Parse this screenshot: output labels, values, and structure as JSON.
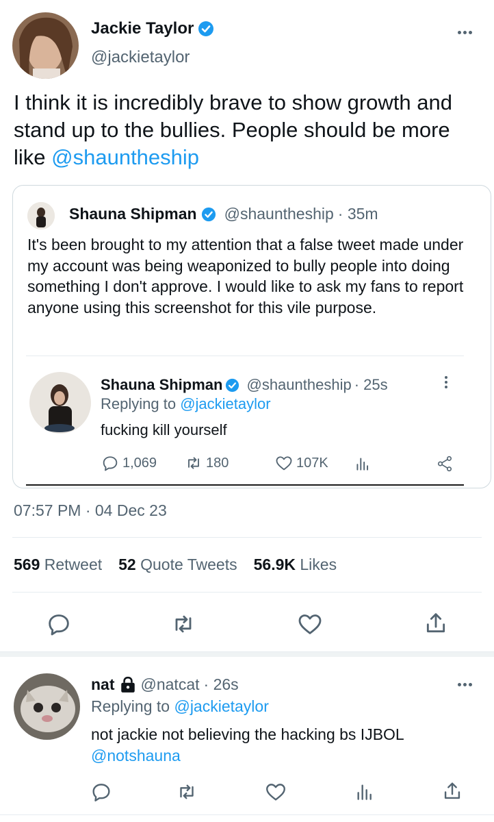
{
  "main_tweet": {
    "author_name": "Jackie Taylor",
    "author_handle": "@jackietaylor",
    "text_before": "I think it is incredibly brave to show growth and stand up to the bullies. People should be more like ",
    "mention": "@shauntheship",
    "timestamp": "07:57 PM · 04 Dec 23",
    "stats": {
      "retweets_count": "569",
      "retweets_label": "Retweet",
      "quotes_count": "52",
      "quotes_label": "Quote Tweets",
      "likes_count": "56.9K",
      "likes_label": "Likes"
    }
  },
  "quoted_tweet": {
    "author_name": "Shauna Shipman",
    "author_handle": "@shauntheship",
    "time": "· 35m",
    "text": "It's been brought to my attention that a false tweet made under my account was being weaponized to bully people into doing something I don't approve. I would like to ask my fans to report anyone using this screenshot for this vile purpose."
  },
  "inner_screenshot": {
    "author_name": "Shauna Shipman",
    "author_handle": "@shauntheship",
    "time": "· 25s",
    "replying_prefix": "Replying to ",
    "replying_to": "@jackietaylor",
    "text": "fucking kill yourself",
    "replies": "1,069",
    "retweets": "180",
    "likes": "107K"
  },
  "reply_tweet": {
    "author_name": "nat",
    "author_handle": "@natcat",
    "time": "· 26s",
    "replying_prefix": "Replying to ",
    "replying_to": "@jackietaylor",
    "text_line1": "not jackie not believing the hacking bs IJBOL",
    "mention": "@notshauna"
  },
  "colors": {
    "accent": "#1d9bf0",
    "muted": "#536471",
    "text": "#0f1419",
    "divider": "#e6ecf0"
  }
}
